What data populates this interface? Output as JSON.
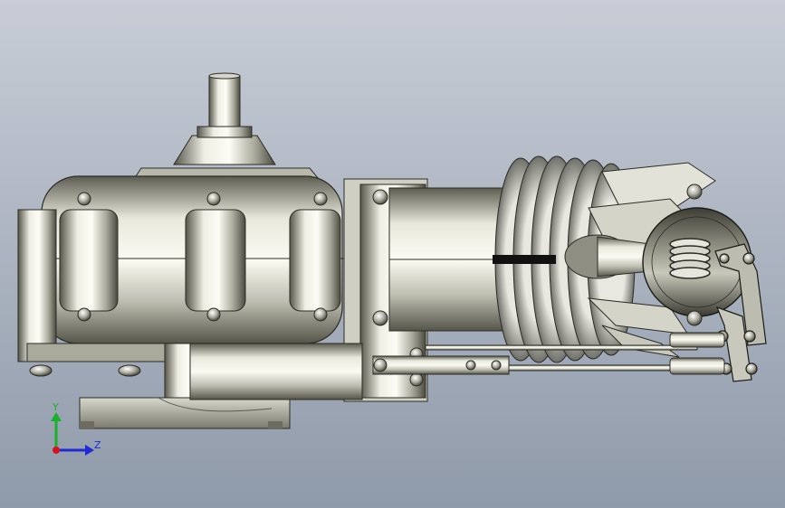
{
  "viewport": {
    "background_top": "#c8cdd6",
    "background_bottom": "#8f9aaa"
  },
  "triad": {
    "y_label": "Y",
    "z_label": "Z",
    "y_color": "#19b02b",
    "z_color": "#1e2ad8",
    "x_color": "#d8121c"
  }
}
